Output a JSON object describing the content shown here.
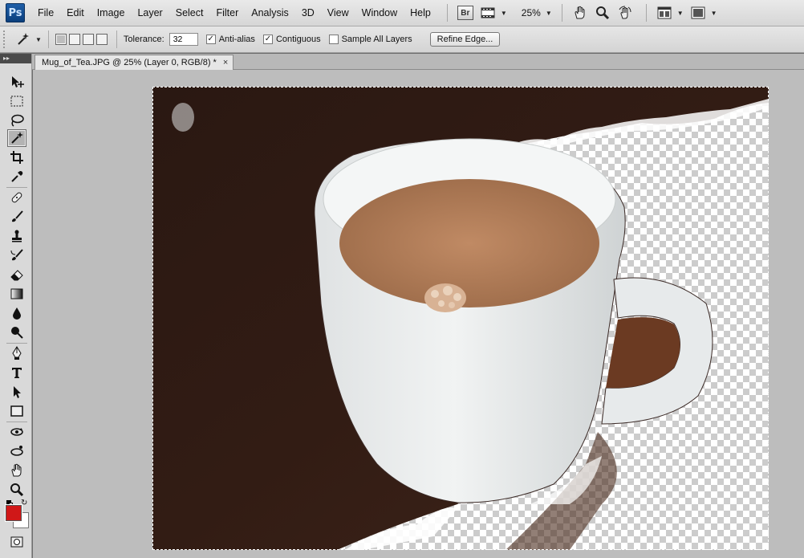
{
  "app": {
    "logo": "Ps"
  },
  "menu": [
    "File",
    "Edit",
    "Image",
    "Layer",
    "Select",
    "Filter",
    "Analysis",
    "3D",
    "View",
    "Window",
    "Help"
  ],
  "appbar": {
    "bridge_label": "Br",
    "zoom_value": "25%"
  },
  "options": {
    "tolerance_label": "Tolerance:",
    "tolerance_value": "32",
    "anti_alias_label": "Anti-alias",
    "anti_alias_checked": true,
    "contiguous_label": "Contiguous",
    "contiguous_checked": true,
    "sample_all_layers_label": "Sample All Layers",
    "sample_all_layers_checked": false,
    "refine_edge_label": "Refine Edge..."
  },
  "document": {
    "tab_title": "Mug_of_Tea.JPG @ 25% (Layer 0, RGB/8) *",
    "close_glyph": "×"
  },
  "toolbox": {
    "collapse_glyph": "▸▸",
    "active_tool": "magic-wand"
  },
  "colors": {
    "foreground": "#d01818",
    "background": "#ffffff",
    "table": "#2a1812",
    "mug": "#eef0f0",
    "tea": "#b7845e"
  }
}
